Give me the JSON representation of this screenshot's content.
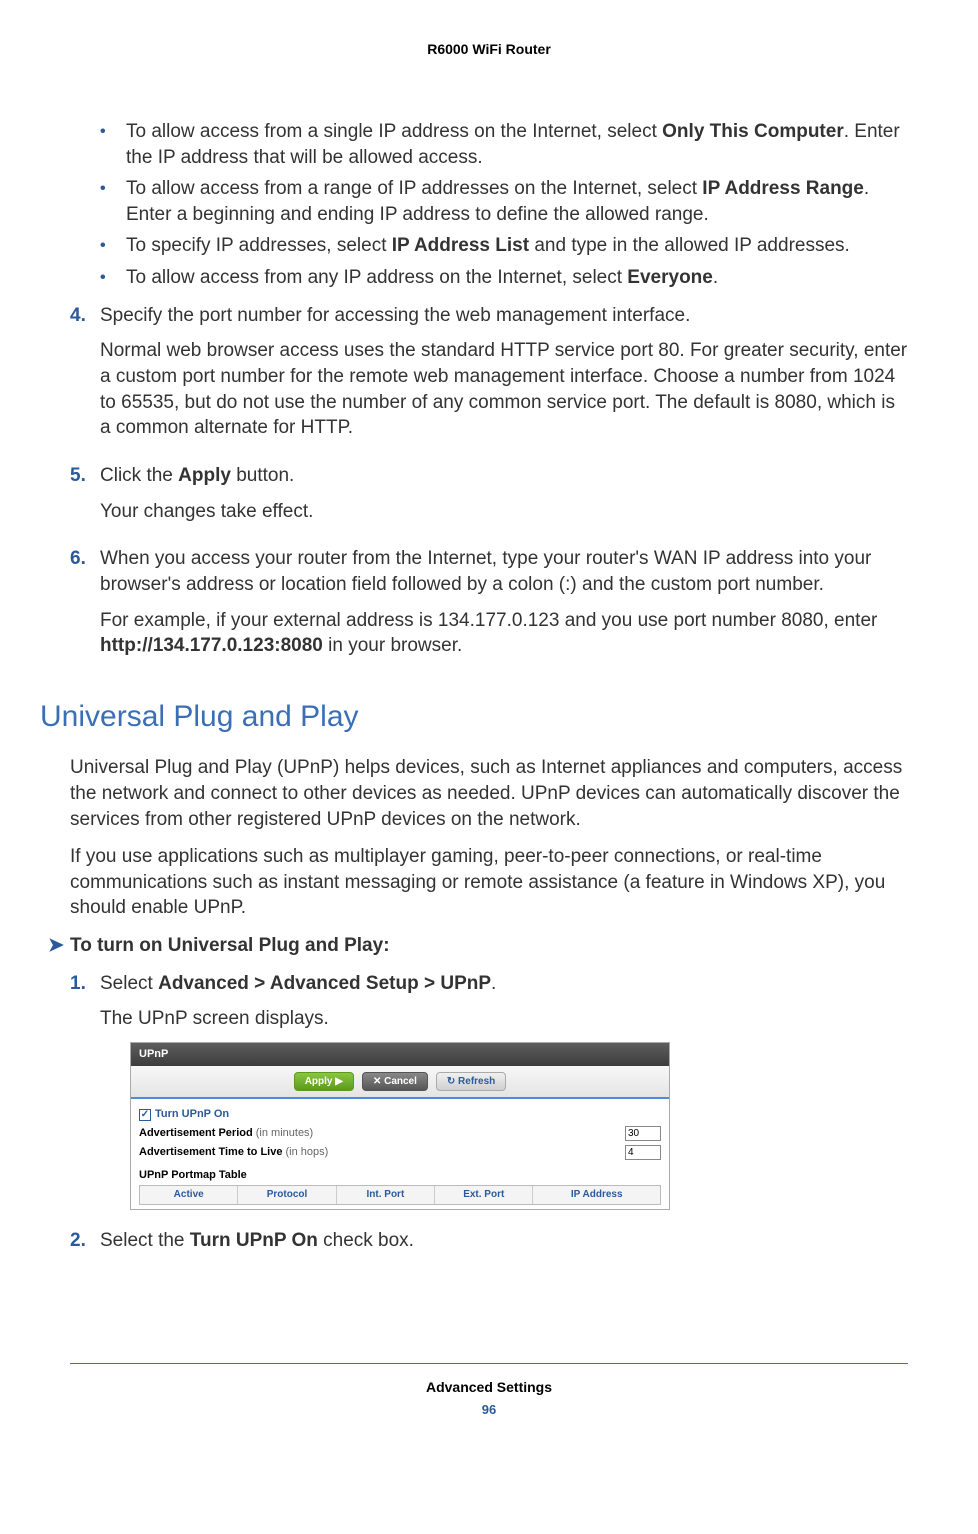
{
  "header": {
    "product": "R6000 WiFi Router"
  },
  "bullets": [
    {
      "pre": "To allow access from a single IP address on the Internet, select ",
      "bold": "Only This Computer",
      "post": ". Enter the IP address that will be allowed access."
    },
    {
      "pre": "To allow access from a range of IP addresses on the Internet, select ",
      "bold": "IP Address Range",
      "post": ". Enter a beginning and ending IP address to define the allowed range."
    },
    {
      "pre": "To specify IP addresses, select ",
      "bold": "IP Address List",
      "post": " and type in the allowed IP addresses."
    },
    {
      "pre": "To allow access from any IP address on the Internet, select ",
      "bold": "Everyone",
      "post": "."
    }
  ],
  "step4": {
    "num": "4.",
    "line1": "Specify the port number for accessing the web management interface.",
    "line2": "Normal web browser access uses the standard HTTP service port 80. For greater security, enter a custom port number for the remote web management interface. Choose a number from 1024 to 65535, but do not use the number of any common service port. The default is 8080, which is a common alternate for HTTP."
  },
  "step5": {
    "num": "5.",
    "line1_pre": "Click the ",
    "line1_bold": "Apply",
    "line1_post": " button.",
    "line2": "Your changes take effect."
  },
  "step6": {
    "num": "6.",
    "line1": "When you access your router from the Internet, type your router's WAN IP address into your browser's address or location field followed by a colon (:) and the custom port number.",
    "line2_pre": "For example, if your external address is 134.177.0.123 and you use port number 8080, enter ",
    "line2_bold": "http://134.177.0.123:8080",
    "line2_post": " in your browser."
  },
  "section": {
    "heading": "Universal Plug and Play"
  },
  "upnp_p1": "Universal Plug and Play (UPnP) helps devices, such as Internet appliances and computers, access the network and connect to other devices as needed. UPnP devices can automatically discover the services from other registered UPnP devices on the network.",
  "upnp_p2": "If you use applications such as multiplayer gaming, peer-to-peer connections, or real-time communications such as instant messaging or remote assistance (a feature in Windows XP), you should enable UPnP.",
  "procedure": {
    "title": "To turn on Universal Plug and Play:"
  },
  "proc1": {
    "num": "1.",
    "line1_pre": "Select ",
    "line1_bold": "Advanced > Advanced Setup > UPnP",
    "line1_post": ".",
    "line2": "The UPnP screen displays."
  },
  "proc2": {
    "num": "2.",
    "line1_pre": "Select the ",
    "line1_bold": "Turn UPnP On",
    "line1_post": " check box."
  },
  "shot": {
    "title": "UPnP",
    "apply": "Apply ▶",
    "cancel": "✕ Cancel",
    "refresh": "↻ Refresh",
    "turn_on": "Turn UPnP On",
    "adv_period_label": "Advertisement Period",
    "adv_period_unit": " (in minutes)",
    "adv_period_value": "30",
    "adv_ttl_label": "Advertisement Time to Live",
    "adv_ttl_unit": " (in hops)",
    "adv_ttl_value": "4",
    "portmap_label": "UPnP Portmap Table",
    "cols": {
      "c1": "Active",
      "c2": "Protocol",
      "c3": "Int. Port",
      "c4": "Ext. Port",
      "c5": "IP Address"
    }
  },
  "footer": {
    "chapter": "Advanced Settings",
    "page": "96"
  }
}
